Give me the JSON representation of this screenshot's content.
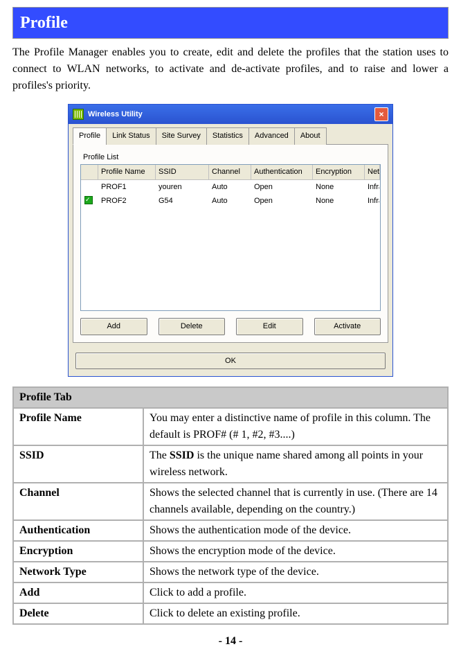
{
  "section_title": "Profile",
  "intro_text": "The Profile Manager enables you to create, edit and delete the profiles that the station uses to connect to WLAN networks, to activate and de-activate profiles, and to raise and lower a profiles's priority.",
  "window": {
    "title": "Wireless Utility",
    "close_icon": "×",
    "tabs": [
      "Profile",
      "Link Status",
      "Site Survey",
      "Statistics",
      "Advanced",
      "About"
    ],
    "groupbox_label": "Profile List",
    "columns": [
      "Profile Name",
      "SSID",
      "Channel",
      "Authentication",
      "Encryption",
      "Network Ty..."
    ],
    "rows": [
      {
        "checked": false,
        "pn": "PROF1",
        "ss": "youren",
        "ch": "Auto",
        "au": "Open",
        "en": "None",
        "nt": "Infrastructure"
      },
      {
        "checked": true,
        "pn": "PROF2",
        "ss": "G54",
        "ch": "Auto",
        "au": "Open",
        "en": "None",
        "nt": "Infrastructure"
      }
    ],
    "buttons": {
      "add": "Add",
      "delete": "Delete",
      "edit": "Edit",
      "activate": "Activate",
      "ok": "OK"
    }
  },
  "table": {
    "header": "Profile Tab",
    "rows": [
      {
        "k": "Profile Name",
        "v": "You may enter a distinctive name of profile in this column. The default is PROF# (# 1, #2, #3....)"
      },
      {
        "k": "SSID",
        "v_pre": "The ",
        "v_bold": "SSID",
        "v_post": " is the unique name shared among all points in your wireless network."
      },
      {
        "k": "Channel",
        "v": "Shows the selected channel that is currently in use. (There are 14 channels available, depending on the country.)"
      },
      {
        "k": "Authentication",
        "v": "Shows the authentication mode of the device."
      },
      {
        "k": "Encryption",
        "v": "Shows the encryption mode of the device."
      },
      {
        "k": "Network Type",
        "v": "Shows the network type of the device."
      },
      {
        "k": "Add",
        "v": "Click to add a profile."
      },
      {
        "k": "Delete",
        "v": "Click to delete an existing profile."
      }
    ]
  },
  "page_number": "- 14 -"
}
